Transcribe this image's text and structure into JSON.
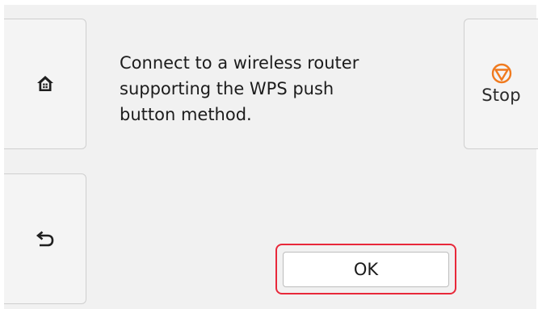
{
  "message": {
    "text": "Connect to a wireless router\nsupporting the WPS push\nbutton method."
  },
  "buttons": {
    "home_icon": "home-icon",
    "back_icon": "back-arrow-icon",
    "stop_icon": "stop-icon",
    "stop_label": "Stop",
    "ok_label": "OK"
  },
  "colors": {
    "stop_icon": "#f07a1e",
    "highlight": "#e8283a"
  }
}
